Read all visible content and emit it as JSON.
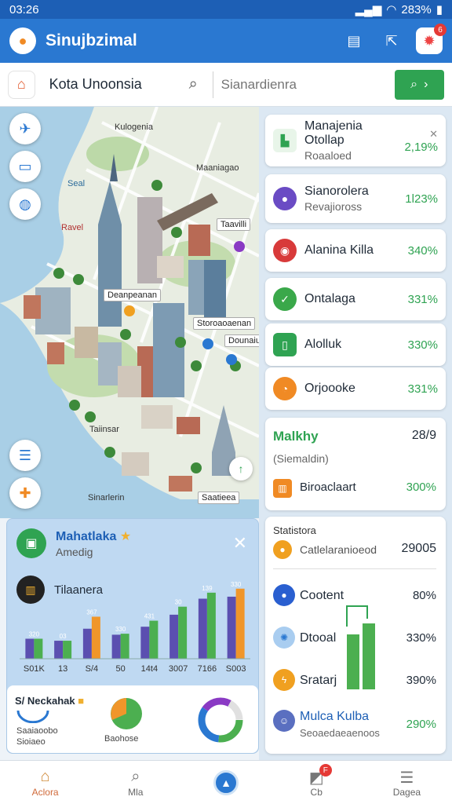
{
  "status_bar": {
    "time": "03:26",
    "battery": "283%"
  },
  "app_bar": {
    "title": "Sinujbzimal",
    "notification_count": "6"
  },
  "search": {
    "location_label": "Kota Unoonsia",
    "placeholder": "Sianardienra"
  },
  "map": {
    "labels": {
      "seal": "Seal",
      "ravel": "Ravel",
      "district_1": "Kulogenia",
      "district_2": "Maaniagao",
      "pin_1": "Taavilli",
      "callout_1": "Deanpeanan",
      "callout_2": "Storoaoaenan",
      "callout_3": "Dounaiuo",
      "area_1": "Taiinsar",
      "area_2": "Sinarlerin",
      "area_3": "Saatieea"
    }
  },
  "right_list": [
    {
      "title": "Manajenia Otollap",
      "subtitle": "Roaaloed",
      "value": "2,19%",
      "icon": "map-icon",
      "color": "#2fa352"
    },
    {
      "title": "Sianorolera",
      "subtitle": "Revajioross",
      "value": "1l23%",
      "icon": "circle-icon",
      "color": "#6a4bc4"
    },
    {
      "title": "Alanina Killa",
      "subtitle": "",
      "value": "340%",
      "icon": "ring-icon",
      "color": "#d83a3a"
    },
    {
      "title": "Ontalaga",
      "subtitle": "",
      "value": "331%",
      "icon": "check-icon",
      "color": "#3aa84a"
    },
    {
      "title": "Alolluk",
      "subtitle": "",
      "value": "330%",
      "icon": "phone-icon",
      "color": "#2fa352"
    },
    {
      "title": "Orjoooke",
      "subtitle": "",
      "value": "331%",
      "icon": "clock-icon",
      "color": "#f08a24"
    }
  ],
  "malkhy_card": {
    "title": "Malkhy",
    "score": "28/9",
    "subtitle": "(Siemaldin)",
    "item_label": "Biroaclaart",
    "item_value": "300%"
  },
  "stats_card": {
    "title": "Statistora",
    "header_label": "Catlelaranioeod",
    "header_value": "29005",
    "rows": [
      {
        "label": "Cootent",
        "value": "80%",
        "color": "#2a5fd0"
      },
      {
        "label": "Dtooal",
        "value": "330%",
        "color": "#2a78d1"
      },
      {
        "label": "Sratarj",
        "value": "390%",
        "color": "#f0a020"
      },
      {
        "label": "Mulca Kulba",
        "sub": "Seoaedaeaenoos",
        "value": "290%",
        "color": "#5a6fc0"
      }
    ]
  },
  "chart_panel": {
    "title": "Mahatlaka",
    "subtitle": "Amedig",
    "legend_label": "Tilaanera",
    "mini_title": "S/ Neckahak",
    "mini_sub1": "Saaiaoobo",
    "mini_sub2": "Sioiaeo",
    "mini_pie_label": "Baohose",
    "colors": {
      "purple": "#5b4fb0",
      "green": "#4caf50",
      "orange": "#f0962a"
    }
  },
  "chart_data": {
    "type": "bar",
    "categories": [
      "S01K",
      "13",
      "S/4",
      "50",
      "14t4",
      "3007",
      "7166",
      "S003"
    ],
    "series": [
      {
        "values": [
          20,
          18,
          30,
          24,
          32,
          44,
          60,
          62
        ]
      },
      {
        "values": [
          20,
          18,
          42,
          25,
          38,
          52,
          66,
          70
        ]
      }
    ],
    "value_labels": [
      "320",
      "03",
      "367",
      "330",
      "431",
      "30",
      "139",
      "330"
    ],
    "ylim": [
      0,
      80
    ]
  },
  "bottom_nav": [
    {
      "label": "Aclora",
      "icon": "home-icon"
    },
    {
      "label": "Mla",
      "icon": "search-icon"
    },
    {
      "label": "",
      "icon": "location-icon"
    },
    {
      "label": "Cb",
      "icon": "chat-icon",
      "badge": "F"
    },
    {
      "label": "Dagea",
      "icon": "menu-icon"
    }
  ]
}
